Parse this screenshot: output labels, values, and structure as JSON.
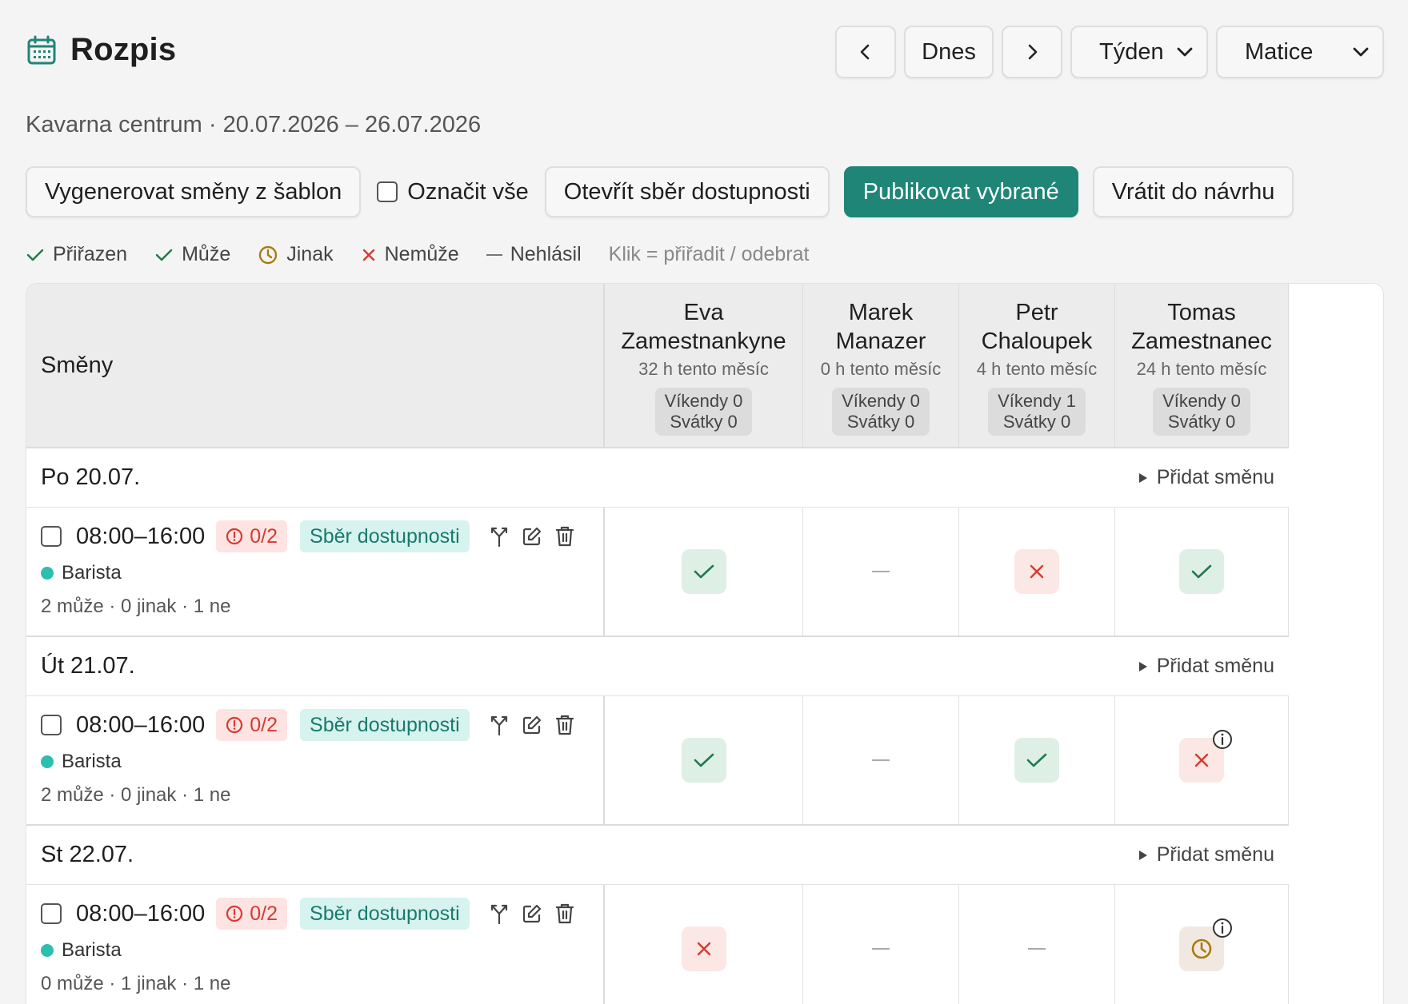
{
  "app": {
    "title": "Rozpis",
    "subtitle": "Kavarna centrum · 20.07.2026 – 26.07.2026"
  },
  "nav": {
    "today_label": "Dnes",
    "period_select": "Týden",
    "view_select": "Matice"
  },
  "toolbar": {
    "generate_label": "Vygenerovat směny z šablon",
    "select_all_label": "Označit vše",
    "open_collect_label": "Otevřít sběr dostupnosti",
    "publish_label": "Publikovat vybrané",
    "revert_label": "Vrátit do návrhu"
  },
  "legend": {
    "assigned": "Přiřazen",
    "can": "Může",
    "other": "Jinak",
    "cannot": "Nemůže",
    "none": "Nehlásil",
    "hint": "Klik = přiřadit / odebrat"
  },
  "table": {
    "shifts_header": "Směny",
    "add_shift_label": "Přidat směnu",
    "employees": [
      {
        "first": "Eva",
        "last": "Zamestnankyne",
        "hours": "32 h tento měsíc",
        "weekends": "Víkendy 0",
        "holidays": "Svátky 0"
      },
      {
        "first": "Marek",
        "last": "Manazer",
        "hours": "0 h tento měsíc",
        "weekends": "Víkendy 0",
        "holidays": "Svátky 0"
      },
      {
        "first": "Petr",
        "last": "Chaloupek",
        "hours": "4 h tento měsíc",
        "weekends": "Víkendy 1",
        "holidays": "Svátky 0"
      },
      {
        "first": "Tomas",
        "last": "Zamestnanec",
        "hours": "24 h tento měsíc",
        "weekends": "Víkendy 0",
        "holidays": "Svátky 0"
      }
    ],
    "days": [
      {
        "label": "Po 20.07.",
        "shift": {
          "time": "08:00–16:00",
          "count": "0/2",
          "status": "Sběr dostupnosti",
          "role": "Barista",
          "stats": "2 může · 0 jinak · 1 ne"
        }
      },
      {
        "label": "Út 21.07.",
        "shift": {
          "time": "08:00–16:00",
          "count": "0/2",
          "status": "Sběr dostupnosti",
          "role": "Barista",
          "stats": "2 může · 0 jinak · 1 ne"
        }
      },
      {
        "label": "St 22.07.",
        "shift": {
          "time": "08:00–16:00",
          "count": "0/2",
          "status": "Sběr dostupnosti",
          "role": "Barista",
          "stats": "0 může · 1 jinak · 1 ne"
        }
      }
    ]
  },
  "colors": {
    "primary": "#1f8577",
    "assigned_bg": "#deefe6",
    "cannot_bg": "#fbe7e4",
    "other_bg": "#f1e9e1",
    "danger": "#d63a30",
    "role_dot": "#2bbfae"
  }
}
